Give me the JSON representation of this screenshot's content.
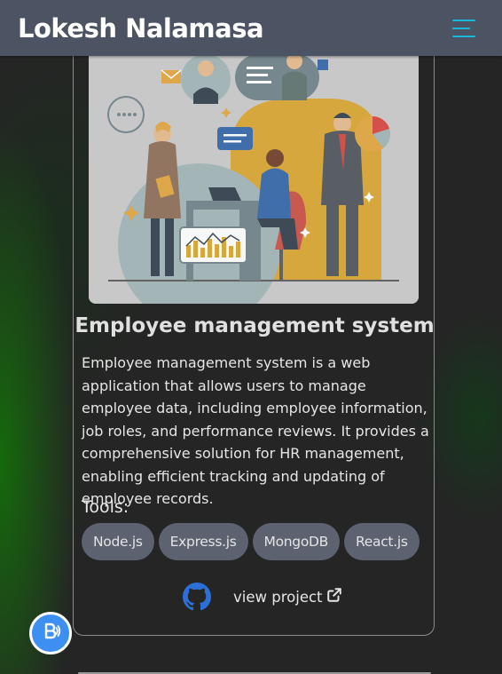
{
  "header": {
    "brand": "Lokesh Nalamasa",
    "menu_icon": "hamburger-menu-icon",
    "accent_color": "#19b6d8"
  },
  "project": {
    "image_icon": "team-collaboration-illustration",
    "title": "Employee management system",
    "description": "Employee management system is a web application that allows users to manage employee data, including employee information, job roles, and performance reviews. It provides a comprehensive solution for HR management, enabling efficient tracking and updating of employee records.",
    "tools_label": "Tools:",
    "tools": [
      "Node.js",
      "Express.js",
      "MongoDB",
      "React.js"
    ],
    "github_icon": "github-icon",
    "view_project_label": "view project",
    "external_link_icon": "external-link-icon"
  },
  "fab": {
    "icon": "bitcoin-b-icon",
    "color": "#3d8ff2"
  }
}
